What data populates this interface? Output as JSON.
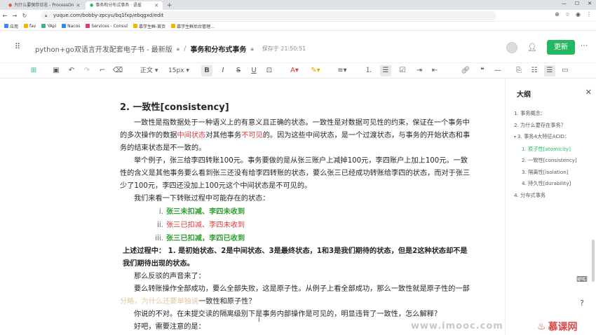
{
  "browser": {
    "tabs": [
      {
        "title": "为什么要保存日志 - ProcessOn",
        "active": false
      },
      {
        "title": "事务和分布式事务 · 语雀",
        "active": true
      }
    ],
    "url": "yuque.com/bobby-zpcyu/bq1fxp/ebqgxd/edit",
    "bookmarks": [
      "应用",
      "fav",
      "YApi",
      "Nacos",
      "Services - Consul",
      "慕学生鲜-首页",
      "慕学生鲜后台管理..."
    ]
  },
  "header": {
    "book_title": "python+go双语言开发配套电子书 - 最新版",
    "doc_title": "事务和分布式事务",
    "save_status": "保存于 21:50:51",
    "update_label": "更新"
  },
  "toolbar": {
    "style_label": "正文",
    "font_size": "15px"
  },
  "content": {
    "heading": "2. 一致性[consistency]",
    "p1_a": "一致性是指数据处于一种语义上的有意义且正确的状态。一致性是对数据可见性的约束，保证在一个事务中的多次操作的数据",
    "p1_red1": "中间状态",
    "p1_b": "对其他事务",
    "p1_red2": "不可见",
    "p1_c": "的。因为这些中间状态，是一个过渡状态，与事务的开始状态和事务的结束状态是不一致的。",
    "p2": "举个例子，张三给李四转账100元。事务要做的是从张三账户上减掉100元，李四账户上加上100元。一致性的含义是其他事务要么看到张三还没有给李四转账的状态，要么张三已经成功转账给李四的状态，而对于张三少了100元，李四还没加上100元这个中间状态是不可见的。",
    "p3": "我们来看一下转账过程中可能存在的状态：",
    "list": [
      {
        "num": "i.",
        "text": "张三未扣减、李四未收到",
        "color": "green"
      },
      {
        "num": "ii.",
        "text": "张三已扣减、李四未收到",
        "color": "red"
      },
      {
        "num": "iii.",
        "text": "张三已扣减，李四已收到",
        "color": "green"
      }
    ],
    "p4_label": "上述过程中：",
    "p4_text": " 1. 是初始状态、2是中间状态、3是最终状态，1和3是我们期待的状态，但是2这种状态却不是我们期待出现的状态。",
    "p5": "那么反驳的声音来了：",
    "p6_a": "要么转账操作全部成功，要么全部失败，这是原子性。从例子上看全部成功，那么一致性就是原子性的一部",
    "p6_blur": "分略，为什么还要单独说",
    "p6_b": "一致性和原子性？",
    "p7": "你说的不对。在未提交读的隔离级别下是事务内部操作是可见的，明显违背了一致性，怎么解释？",
    "p8": "好吧，需要注意的是："
  },
  "outline": {
    "title": "大纲",
    "items": [
      {
        "text": "1. 事务概念：",
        "level": 1,
        "active": false,
        "arrow": false
      },
      {
        "text": "2. 为什么要存在事务？",
        "level": 1,
        "active": false,
        "arrow": false
      },
      {
        "text": "3. 事务4大特征ACID：",
        "level": 1,
        "active": false,
        "arrow": true
      },
      {
        "text": "1. 原子性[atomicity]",
        "level": 2,
        "active": true,
        "arrow": false
      },
      {
        "text": "2. 一致性[consistency]",
        "level": 2,
        "active": false,
        "arrow": false
      },
      {
        "text": "3. 隔离性[isolation]",
        "level": 2,
        "active": false,
        "arrow": false
      },
      {
        "text": "4. 持久性[durability]",
        "level": 2,
        "active": false,
        "arrow": false
      },
      {
        "text": "4. 分布式事务",
        "level": 1,
        "active": false,
        "arrow": false
      }
    ]
  },
  "watermark": "www.imooc.com",
  "logo": "慕课网",
  "colors": {
    "accent": "#25b864",
    "red": "#e03a3a",
    "green": "#2f9e2f"
  }
}
